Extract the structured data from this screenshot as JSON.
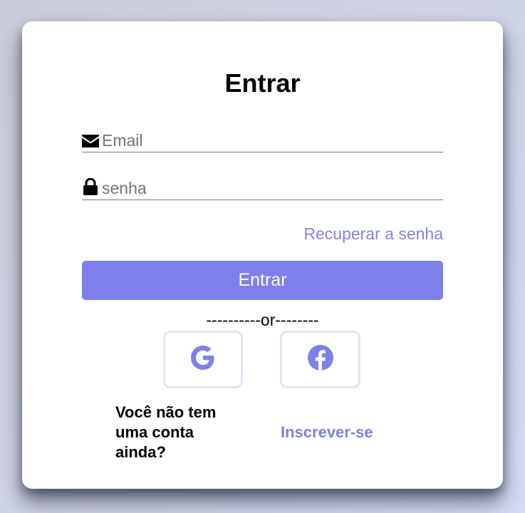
{
  "login": {
    "title": "Entrar",
    "email": {
      "placeholder": "Email",
      "value": "",
      "icon": "envelope-icon"
    },
    "password": {
      "placeholder": "senha",
      "value": "",
      "icon": "lock-icon"
    },
    "forgot_label": "Recuperar a senha",
    "submit_label": "Entrar",
    "divider_text": "----------or--------",
    "social": [
      {
        "name": "google",
        "icon": "google-icon"
      },
      {
        "name": "facebook",
        "icon": "facebook-icon"
      }
    ],
    "signup_prompt": "Você não tem uma conta ainda?",
    "signup_label": "Inscrever-se"
  },
  "colors": {
    "accent": "#7f7fec",
    "link": "#8483e6",
    "social_border": "#dde7f3",
    "card_bg": "#ffffff"
  }
}
